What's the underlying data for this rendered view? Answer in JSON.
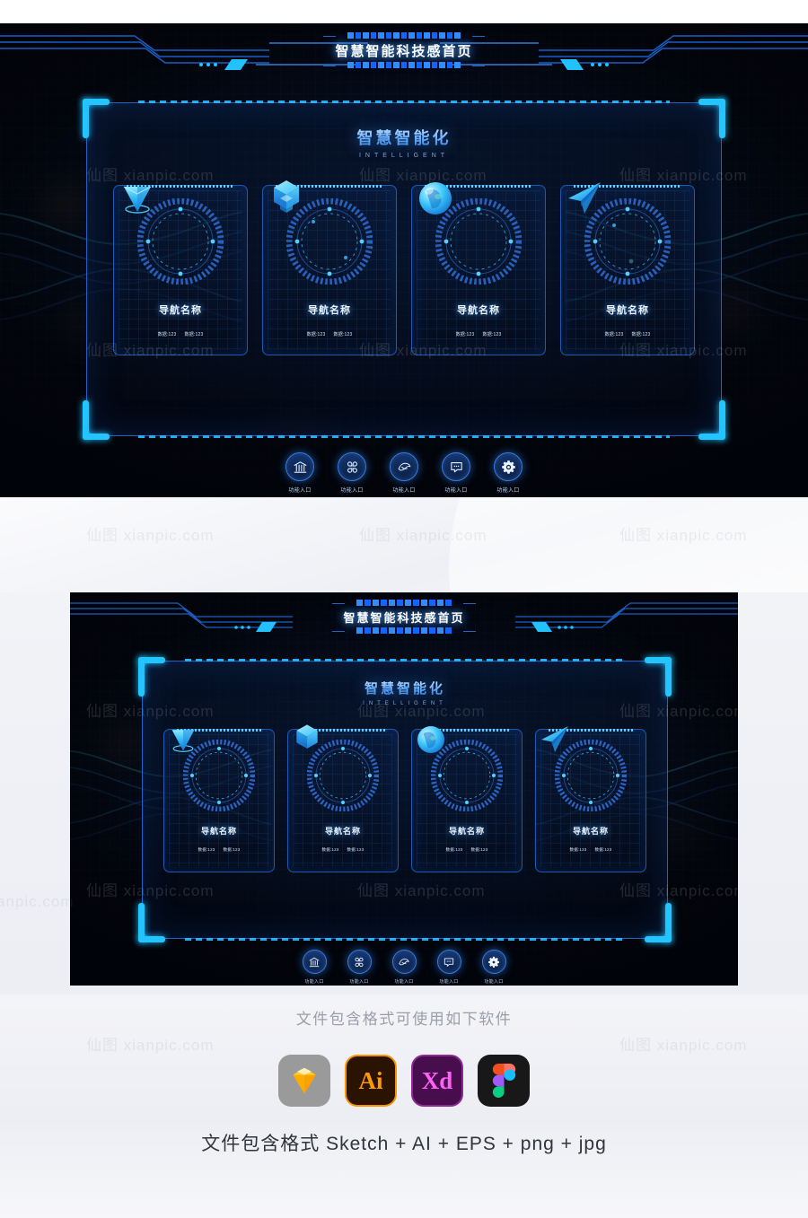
{
  "header": {
    "page_title": "智慧智能科技感首页"
  },
  "hero": {
    "heading_cn": "智慧智能化",
    "heading_en": "INTELLIGENT",
    "cards": [
      {
        "icon": "location-pin-icon",
        "label": "导航名称",
        "stat1": "数据:123",
        "stat2": "数据:123"
      },
      {
        "icon": "cube-blocks-icon",
        "label": "导航名称",
        "stat1": "数据:123",
        "stat2": "数据:123"
      },
      {
        "icon": "sphere-globe-icon",
        "label": "导航名称",
        "stat1": "数据:123",
        "stat2": "数据:123"
      },
      {
        "icon": "paper-plane-icon",
        "label": "导航名称",
        "stat1": "数据:123",
        "stat2": "数据:123"
      }
    ],
    "functions": [
      {
        "icon": "bank-icon",
        "label": "功能入口"
      },
      {
        "icon": "apps-grid-icon",
        "label": "功能入口"
      },
      {
        "icon": "handshake-icon",
        "label": "功能入口"
      },
      {
        "icon": "chat-bubble-icon",
        "label": "功能入口"
      },
      {
        "icon": "gear-icon",
        "label": "功能入口"
      }
    ]
  },
  "watermark": {
    "text": "仙图 xianpic.com"
  },
  "footer": {
    "caption": "文件包含格式可使用如下软件",
    "formats_line": "文件包含格式 Sketch + AI + EPS + png + jpg",
    "apps": [
      {
        "name": "sketch",
        "label": "Sketch"
      },
      {
        "name": "illustrator",
        "label": "Ai"
      },
      {
        "name": "xd",
        "label": "Xd"
      },
      {
        "name": "figma",
        "label": "Figma"
      }
    ]
  },
  "colors": {
    "accent_cyan": "#23c4ff",
    "accent_blue": "#1d63c8",
    "bg_dark": "#04070f",
    "text_light": "#eaf4ff"
  }
}
